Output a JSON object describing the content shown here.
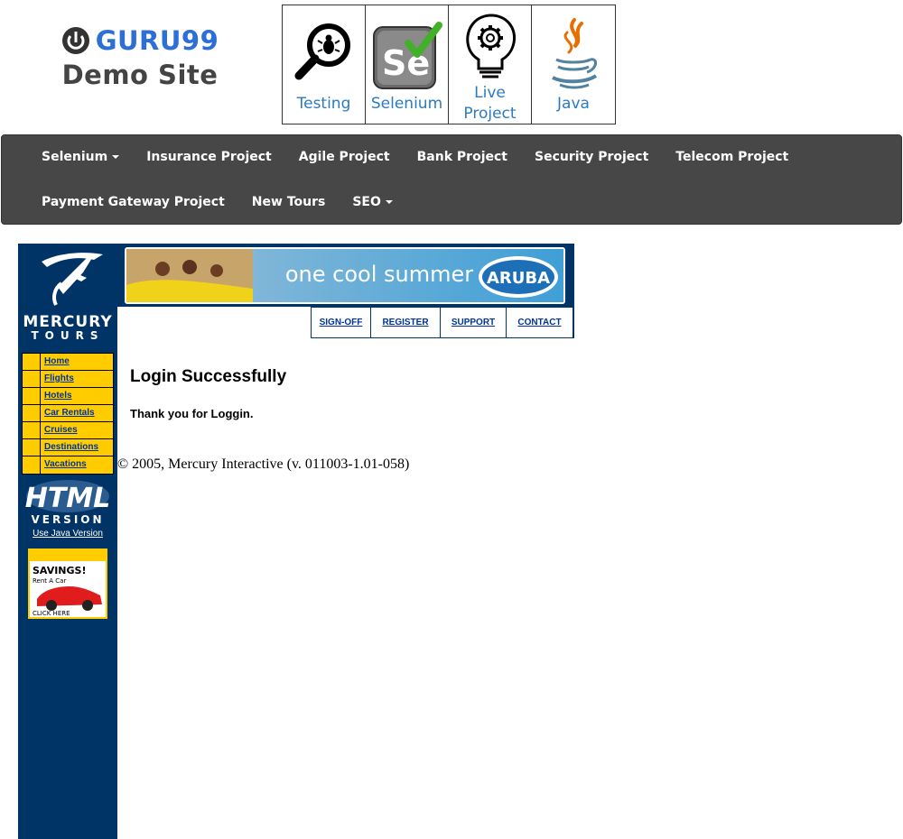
{
  "header": {
    "logo_text": "GURU99",
    "logo_subtitle": "Demo Site",
    "tiles": [
      {
        "label": "Testing",
        "icon": "magnifier-bug-icon"
      },
      {
        "label": "Selenium",
        "icon": "selenium-icon"
      },
      {
        "label_line1": "Live",
        "label_line2": "Project",
        "icon": "lightbulb-gear-icon"
      },
      {
        "label": "Java",
        "icon": "java-icon"
      }
    ]
  },
  "nav": {
    "row1": [
      "Selenium",
      "Insurance Project",
      "Agile Project",
      "Bank Project",
      "Security Project",
      "Telecom Project"
    ],
    "row2": [
      "Payment Gateway Project",
      "New Tours",
      "SEO"
    ]
  },
  "sidebar": {
    "logo_alt": "MERCURY TOURS",
    "menu": [
      "Home",
      "Flights",
      "Hotels",
      "Car Rentals",
      "Cruises",
      "Destinations",
      "Vacations"
    ],
    "java_link": "Use Java Version"
  },
  "banner": {
    "text": "one cool summer",
    "brand": "ARUBA"
  },
  "top_links": [
    "SIGN-OFF",
    "REGISTER",
    "SUPPORT",
    "CONTACT"
  ],
  "content": {
    "title": "Login Successfully",
    "message": "Thank you for Loggin.",
    "copyright": "© 2005, Mercury Interactive (v. 011003-1.01-058)"
  },
  "colors": {
    "navy": "#003366",
    "gold": "#ffcc00",
    "navbar": "#474747",
    "guru_blue": "#2c6fd6"
  }
}
